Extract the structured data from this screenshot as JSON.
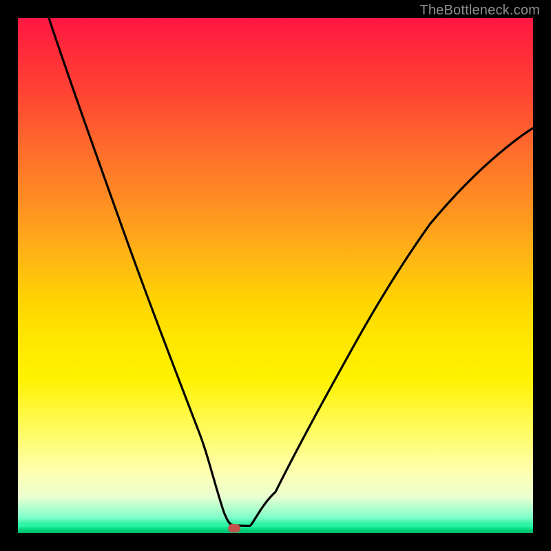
{
  "watermark": "TheBottleneck.com",
  "colors": {
    "top": "#ff1744",
    "mid": "#ffe600",
    "bottom": "#00d27a",
    "curve": "#000000",
    "marker": "#c0534b",
    "frame": "#000000"
  },
  "chart_data": {
    "type": "line",
    "title": "",
    "xlabel": "",
    "ylabel": "",
    "xlim": [
      0,
      100
    ],
    "ylim": [
      0,
      100
    ],
    "grid": false,
    "legend": false,
    "annotation": "TheBottleneck.com",
    "marker": {
      "x": 42,
      "y": 1
    },
    "series": [
      {
        "name": "bottleneck-curve",
        "x": [
          6,
          10,
          15,
          20,
          25,
          30,
          35,
          38,
          40,
          41,
          42,
          43,
          45,
          50,
          55,
          60,
          65,
          70,
          75,
          80,
          85,
          90,
          95,
          100
        ],
        "y": [
          100,
          88,
          74,
          60,
          46,
          33,
          20,
          10,
          4,
          1.5,
          1,
          1,
          1.2,
          4,
          10,
          18,
          27,
          36,
          45,
          53,
          60,
          66,
          71,
          75
        ]
      }
    ]
  }
}
